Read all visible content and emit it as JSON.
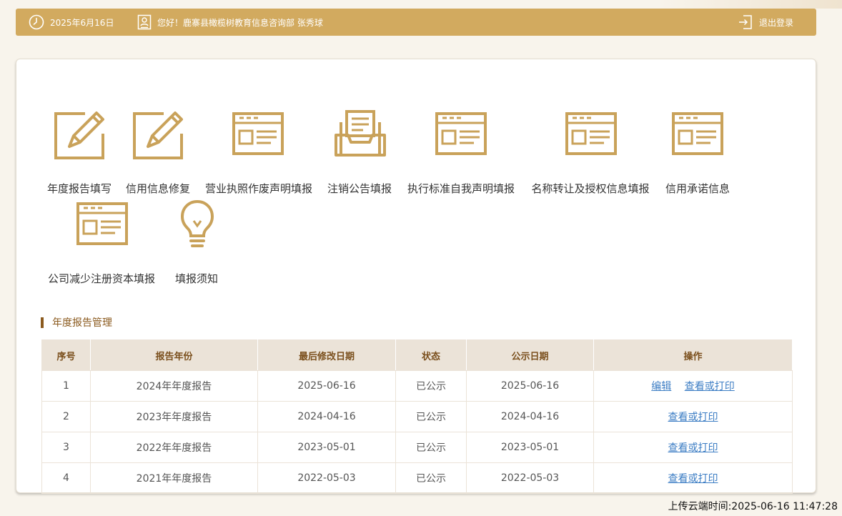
{
  "header": {
    "date": "2025年6月16日",
    "greeting": "您好！鹿寨县橄榄树教育信息咨询部  张秀球",
    "logout_label": "退出登录"
  },
  "functions": [
    {
      "label": "年度报告填写",
      "icon": "edit-icon"
    },
    {
      "label": "信用信息修复",
      "icon": "edit-icon"
    },
    {
      "label": "营业执照作废声明填报",
      "icon": "form-icon"
    },
    {
      "label": "注销公告填报",
      "icon": "inbox-document-icon"
    },
    {
      "label": "执行标准自我声明填报",
      "icon": "form-icon"
    },
    {
      "label": "名称转让及授权信息填报",
      "icon": "form-icon"
    },
    {
      "label": "信用承诺信息",
      "icon": "form-icon"
    },
    {
      "label": "公司减少注册资本填报",
      "icon": "form-icon"
    },
    {
      "label": "填报须知",
      "icon": "lightbulb-icon"
    }
  ],
  "section": {
    "title": "年度报告管理"
  },
  "table": {
    "headers": [
      "序号",
      "报告年份",
      "最后修改日期",
      "状态",
      "公示日期",
      "操作"
    ],
    "rows": [
      {
        "no": "1",
        "year": "2024年年度报告",
        "modified": "2025-06-16",
        "status": "已公示",
        "published": "2025-06-16",
        "actions": [
          "编辑",
          "查看或打印"
        ]
      },
      {
        "no": "2",
        "year": "2023年年度报告",
        "modified": "2024-04-16",
        "status": "已公示",
        "published": "2024-04-16",
        "actions": [
          "查看或打印"
        ]
      },
      {
        "no": "3",
        "year": "2022年年度报告",
        "modified": "2023-05-01",
        "status": "已公示",
        "published": "2023-05-01",
        "actions": [
          "查看或打印"
        ]
      },
      {
        "no": "4",
        "year": "2021年年度报告",
        "modified": "2022-05-03",
        "status": "已公示",
        "published": "2022-05-03",
        "actions": [
          "查看或打印"
        ]
      }
    ]
  },
  "footer": {
    "upload_time": "上传云端时间:2025-06-16 11:47:28"
  },
  "colors": {
    "accent": "#d2aa5f",
    "icon": "#c9a25a",
    "section": "#8b5a1e",
    "link": "#3c7dc4"
  }
}
